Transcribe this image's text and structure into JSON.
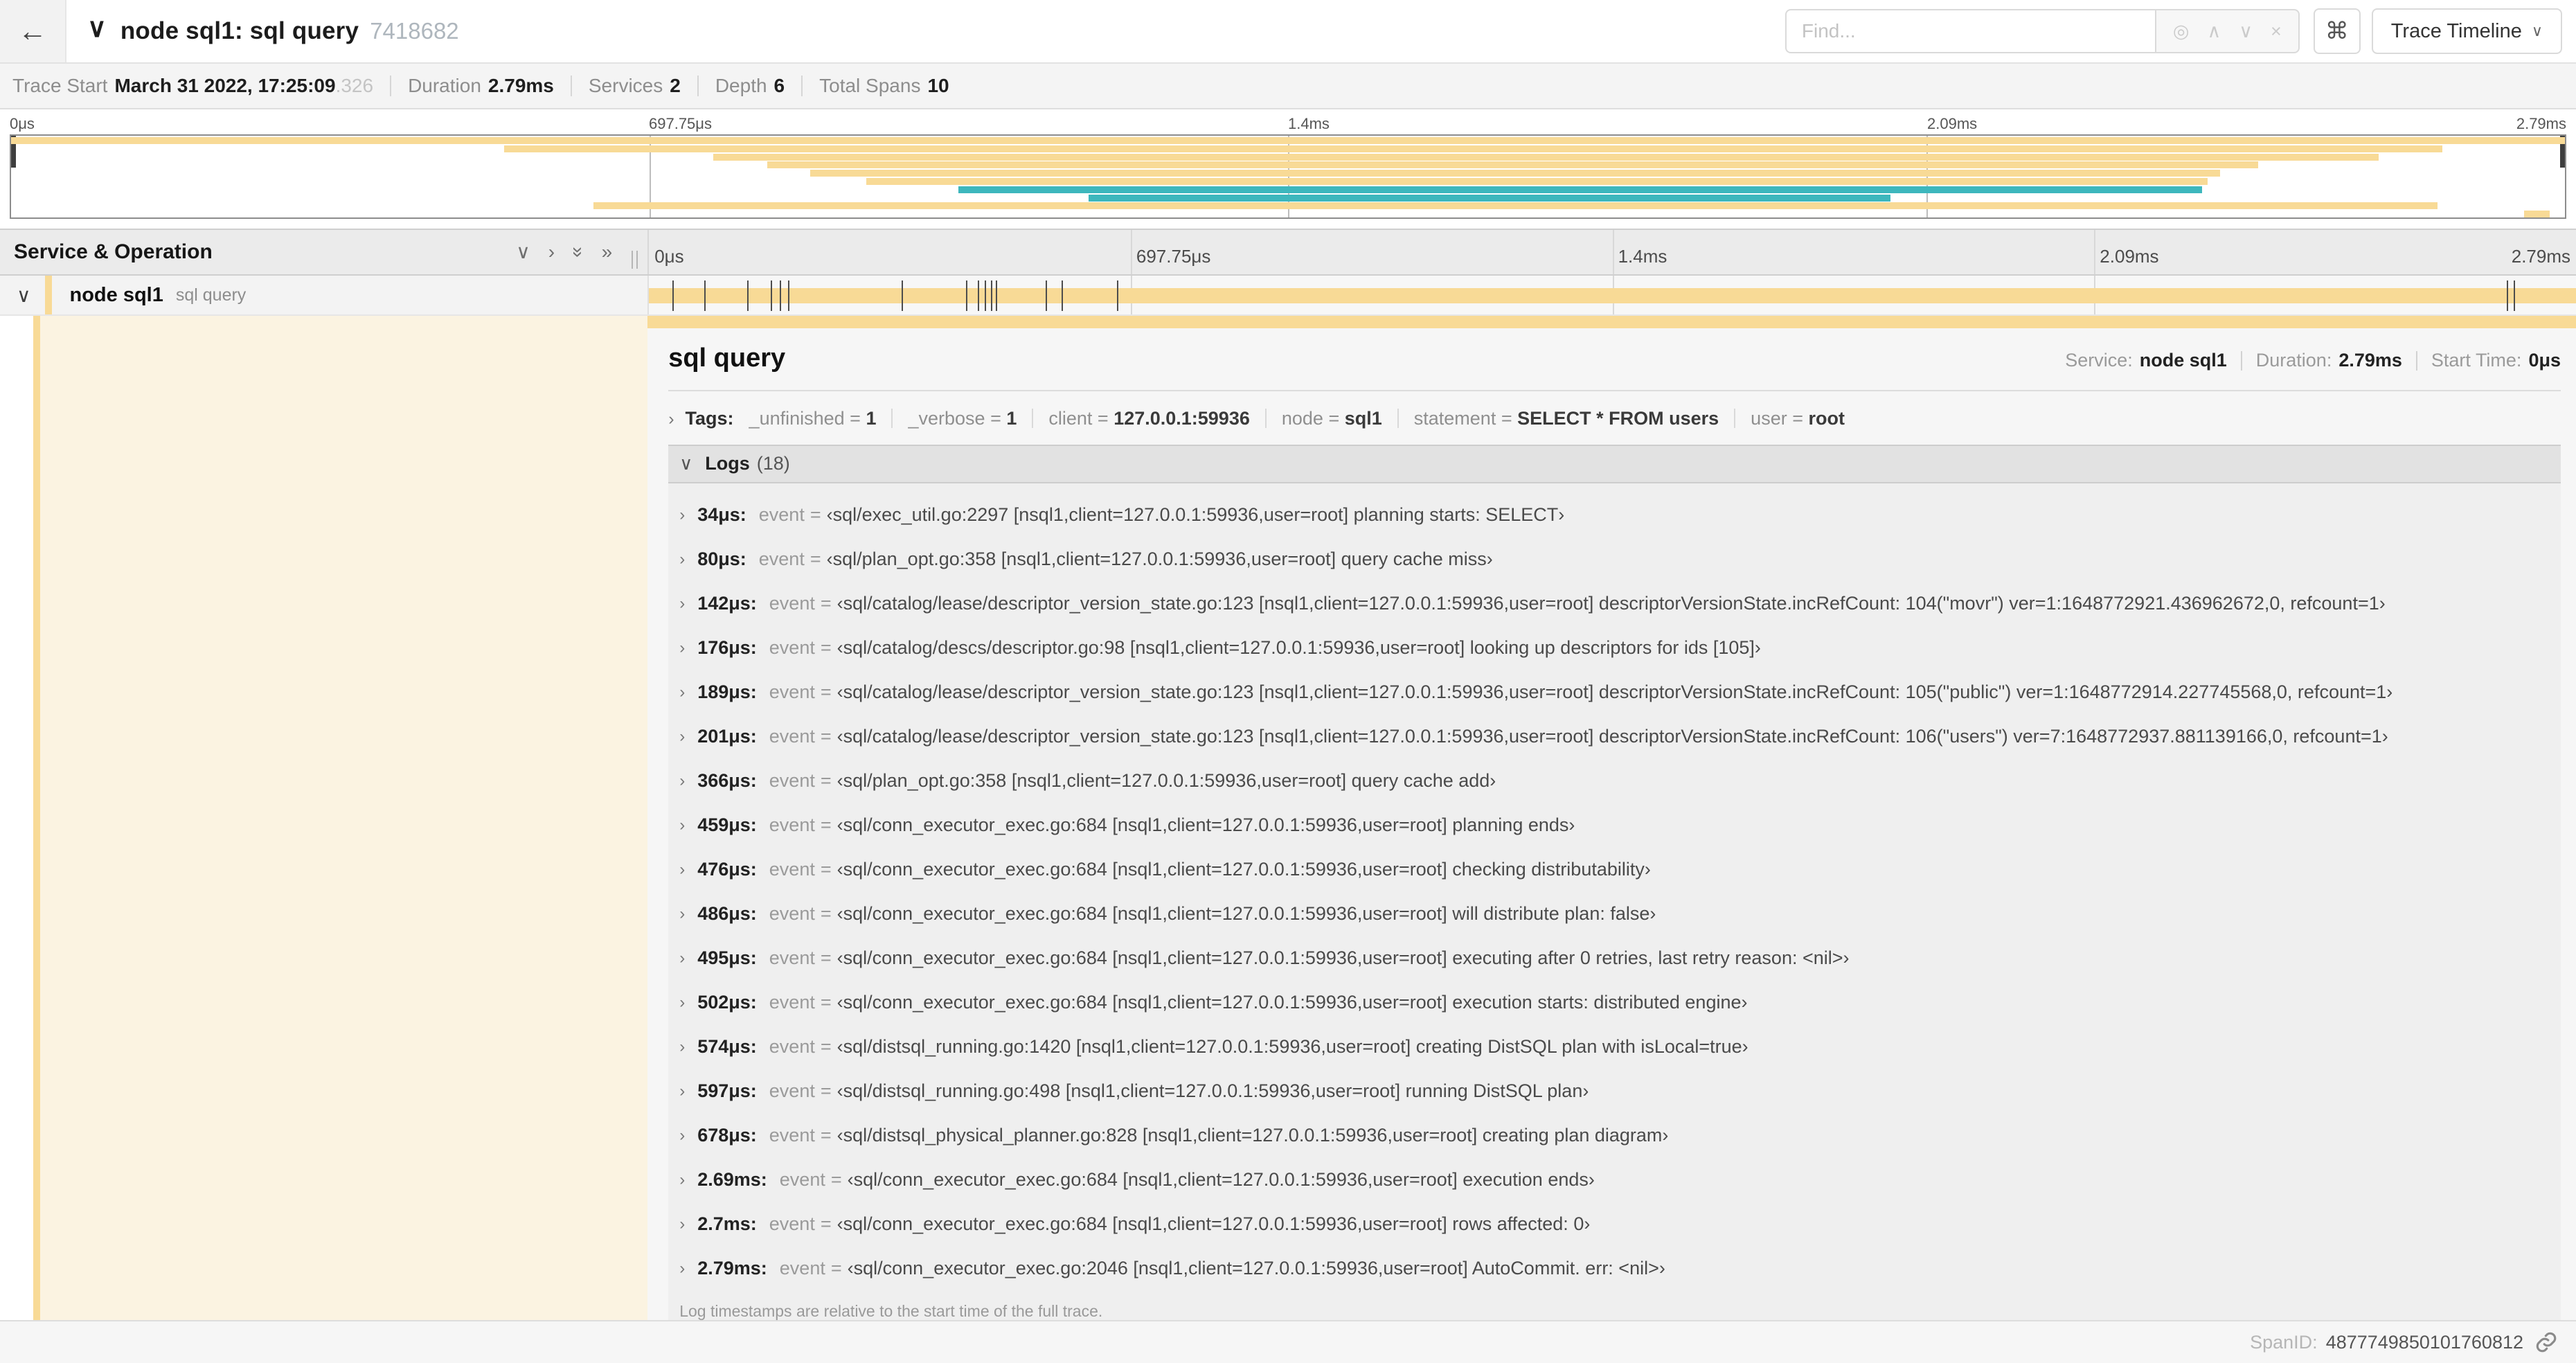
{
  "colors": {
    "tan": "#f8da96",
    "teal": "#3db7bd",
    "cream": "#fbf3e1"
  },
  "header": {
    "back_arrow": "←",
    "collapse_chevron": "∨",
    "title": "node sql1: sql query",
    "trace_id": "7418682",
    "find_placeholder": "Find...",
    "find_icons": [
      "◎",
      "∧",
      "∨",
      "×"
    ],
    "shortcut_button": "⌘",
    "view_selector_label": "Trace Timeline",
    "view_selector_chevron": "∨"
  },
  "summary": {
    "items": [
      {
        "label": "Trace Start",
        "value": "March 31 2022, 17:25:09",
        "suffix": ".326"
      },
      {
        "label": "Duration",
        "value": "2.79ms"
      },
      {
        "label": "Services",
        "value": "2"
      },
      {
        "label": "Depth",
        "value": "6"
      },
      {
        "label": "Total Spans",
        "value": "10"
      }
    ]
  },
  "minimap": {
    "time_labels": [
      "0μs",
      "697.75μs",
      "1.4ms",
      "2.09ms",
      "2.79ms"
    ],
    "label_pcts": [
      0,
      25,
      50,
      75,
      100
    ],
    "grid_pcts": [
      25,
      50,
      75
    ],
    "bars": [
      {
        "start": 0,
        "end": 100,
        "color": "tan"
      },
      {
        "start": 19.3,
        "end": 95.2,
        "color": "tan"
      },
      {
        "start": 27.5,
        "end": 92.7,
        "color": "tan"
      },
      {
        "start": 29.6,
        "end": 88.0,
        "color": "tan"
      },
      {
        "start": 31.3,
        "end": 86.5,
        "color": "tan"
      },
      {
        "start": 33.5,
        "end": 86.0,
        "color": "tan"
      },
      {
        "start": 37.1,
        "end": 85.8,
        "color": "teal"
      },
      {
        "start": 42.2,
        "end": 73.6,
        "color": "teal"
      },
      {
        "start": 22.8,
        "end": 95.0,
        "color": "tan"
      },
      {
        "start": 98.4,
        "end": 99.4,
        "color": "tan"
      }
    ]
  },
  "timeline": {
    "left_header": "Service & Operation",
    "header_icons": [
      "chevron-down",
      "chevron-right",
      "double-chevron-down",
      "double-chevron-right"
    ],
    "ruler_labels": [
      "0μs",
      "697.75μs",
      "1.4ms",
      "2.09ms",
      "2.79ms"
    ],
    "label_pcts": [
      0,
      25,
      50,
      75,
      100
    ],
    "grid_pcts": [
      25,
      50,
      75
    ],
    "span": {
      "chevron": "∨",
      "service": "node sql1",
      "operation": "sql query",
      "ticks_pct": [
        1.22,
        2.87,
        5.09,
        6.31,
        6.77,
        7.2,
        13.12,
        16.45,
        17.06,
        17.42,
        17.74,
        17.99,
        20.57,
        21.4,
        24.3,
        96.42,
        96.77
      ]
    }
  },
  "detail": {
    "title": "sql query",
    "meta": [
      {
        "label": "Service:",
        "value": "node sql1"
      },
      {
        "label": "Duration:",
        "value": "2.79ms"
      },
      {
        "label": "Start Time:",
        "value": "0μs"
      }
    ],
    "tags": {
      "chevron": "›",
      "label": "Tags:",
      "items": [
        {
          "key": "_unfinished",
          "value": "1"
        },
        {
          "key": "_verbose",
          "value": "1"
        },
        {
          "key": "client",
          "value": "127.0.0.1:59936"
        },
        {
          "key": "node",
          "value": "sql1"
        },
        {
          "key": "statement",
          "value": "SELECT * FROM users"
        },
        {
          "key": "user",
          "value": "root"
        }
      ]
    },
    "logs": {
      "chevron": "∨",
      "label": "Logs",
      "count": "(18)",
      "row_chevron": "›",
      "entries": [
        {
          "time": "34μs:",
          "key": "event",
          "value": "‹sql/exec_util.go:2297 [nsql1,client=127.0.0.1:59936,user=root] planning starts: SELECT›"
        },
        {
          "time": "80μs:",
          "key": "event",
          "value": "‹sql/plan_opt.go:358 [nsql1,client=127.0.0.1:59936,user=root] query cache miss›"
        },
        {
          "time": "142μs:",
          "key": "event",
          "value": "‹sql/catalog/lease/descriptor_version_state.go:123 [nsql1,client=127.0.0.1:59936,user=root] descriptorVersionState.incRefCount: 104(\"movr\") ver=1:1648772921.436962672,0, refcount=1›"
        },
        {
          "time": "176μs:",
          "key": "event",
          "value": "‹sql/catalog/descs/descriptor.go:98 [nsql1,client=127.0.0.1:59936,user=root] looking up descriptors for ids [105]›"
        },
        {
          "time": "189μs:",
          "key": "event",
          "value": "‹sql/catalog/lease/descriptor_version_state.go:123 [nsql1,client=127.0.0.1:59936,user=root] descriptorVersionState.incRefCount: 105(\"public\") ver=1:1648772914.227745568,0, refcount=1›"
        },
        {
          "time": "201μs:",
          "key": "event",
          "value": "‹sql/catalog/lease/descriptor_version_state.go:123 [nsql1,client=127.0.0.1:59936,user=root] descriptorVersionState.incRefCount: 106(\"users\") ver=7:1648772937.881139166,0, refcount=1›"
        },
        {
          "time": "366μs:",
          "key": "event",
          "value": "‹sql/plan_opt.go:358 [nsql1,client=127.0.0.1:59936,user=root] query cache add›"
        },
        {
          "time": "459μs:",
          "key": "event",
          "value": "‹sql/conn_executor_exec.go:684 [nsql1,client=127.0.0.1:59936,user=root] planning ends›"
        },
        {
          "time": "476μs:",
          "key": "event",
          "value": "‹sql/conn_executor_exec.go:684 [nsql1,client=127.0.0.1:59936,user=root] checking distributability›"
        },
        {
          "time": "486μs:",
          "key": "event",
          "value": "‹sql/conn_executor_exec.go:684 [nsql1,client=127.0.0.1:59936,user=root] will distribute plan: false›"
        },
        {
          "time": "495μs:",
          "key": "event",
          "value": "‹sql/conn_executor_exec.go:684 [nsql1,client=127.0.0.1:59936,user=root] executing after 0 retries, last retry reason: <nil>›"
        },
        {
          "time": "502μs:",
          "key": "event",
          "value": "‹sql/conn_executor_exec.go:684 [nsql1,client=127.0.0.1:59936,user=root] execution starts: distributed engine›"
        },
        {
          "time": "574μs:",
          "key": "event",
          "value": "‹sql/distsql_running.go:1420 [nsql1,client=127.0.0.1:59936,user=root] creating DistSQL plan with isLocal=true›"
        },
        {
          "time": "597μs:",
          "key": "event",
          "value": "‹sql/distsql_running.go:498 [nsql1,client=127.0.0.1:59936,user=root] running DistSQL plan›"
        },
        {
          "time": "678μs:",
          "key": "event",
          "value": "‹sql/distsql_physical_planner.go:828 [nsql1,client=127.0.0.1:59936,user=root] creating plan diagram›"
        },
        {
          "time": "2.69ms:",
          "key": "event",
          "value": "‹sql/conn_executor_exec.go:684 [nsql1,client=127.0.0.1:59936,user=root] execution ends›"
        },
        {
          "time": "2.7ms:",
          "key": "event",
          "value": "‹sql/conn_executor_exec.go:684 [nsql1,client=127.0.0.1:59936,user=root] rows affected: 0›"
        },
        {
          "time": "2.79ms:",
          "key": "event",
          "value": "‹sql/conn_executor_exec.go:2046 [nsql1,client=127.0.0.1:59936,user=root] AutoCommit. err: <nil>›"
        }
      ]
    },
    "footer_note": "Log timestamps are relative to the start time of the full trace.",
    "span_id_label": "SpanID:",
    "span_id": "4877749850101760812"
  }
}
